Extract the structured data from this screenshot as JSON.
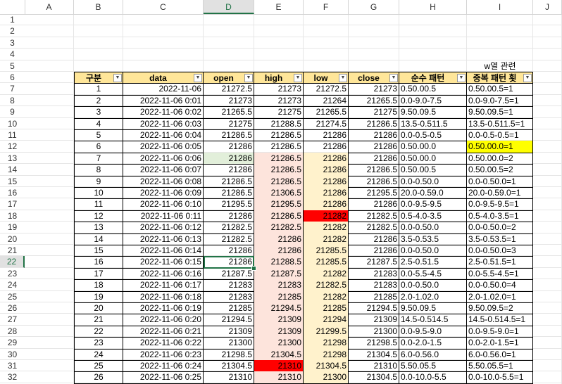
{
  "columns": [
    "A",
    "B",
    "C",
    "D",
    "E",
    "F",
    "G",
    "H",
    "I",
    "J"
  ],
  "selected_column": "D",
  "selected_row": 22,
  "rows": [
    1,
    2,
    3,
    4,
    5,
    6,
    7,
    8,
    9,
    10,
    11,
    12,
    13,
    14,
    15,
    16,
    17,
    18,
    19,
    20,
    21,
    22,
    23,
    24,
    25,
    26,
    27,
    28,
    29,
    30,
    31,
    32
  ],
  "note_cell": "w열 관련",
  "headers": [
    "구분",
    "data",
    "open",
    "high",
    "low",
    "close",
    "순수 패턴",
    "중복 패턴 횟"
  ],
  "filter_icon": "dropdown-arrow-icon",
  "colors": {
    "header_fill": "#ffe699",
    "red": "#ff0000",
    "yellow": "#ffff00",
    "pink_light": "#fde4dc",
    "orange_light": "#fff2cc",
    "green_light": "#e2efda",
    "selection": "#217346"
  },
  "data": [
    {
      "n": "1",
      "dt": "2022-11-06",
      "o": "21272.5",
      "h": "21273",
      "l": "21272.5",
      "c": "21273",
      "p": "0.50.00.5",
      "q": "0.50.00.5=1"
    },
    {
      "n": "2",
      "dt": "2022-11-06 0:01",
      "o": "21273",
      "h": "21273",
      "l": "21264",
      "c": "21265.5",
      "p": "0.0-9.0-7.5",
      "q": "0.0-9.0-7.5=1"
    },
    {
      "n": "3",
      "dt": "2022-11-06 0:02",
      "o": "21265.5",
      "h": "21275",
      "l": "21265.5",
      "c": "21275",
      "p": "9.50.09.5",
      "q": "9.50.09.5=1"
    },
    {
      "n": "4",
      "dt": "2022-11-06 0:03",
      "o": "21275",
      "h": "21288.5",
      "l": "21274.5",
      "c": "21286.5",
      "p": "13.5-0.511.5",
      "q": "13.5-0.511.5=1"
    },
    {
      "n": "5",
      "dt": "2022-11-06 0:04",
      "o": "21286.5",
      "h": "21286.5",
      "l": "21286",
      "c": "21286",
      "p": "0.0-0.5-0.5",
      "q": "0.0-0.5-0.5=1"
    },
    {
      "n": "6",
      "dt": "2022-11-06 0:05",
      "o": "21286",
      "h": "21286.5",
      "l": "21286",
      "c": "21286",
      "p": "0.50.00.0",
      "q": "0.50.00.0=1"
    },
    {
      "n": "7",
      "dt": "2022-11-06 0:06",
      "o": "21286",
      "h": "21286.5",
      "l": "21286",
      "c": "21286",
      "p": "0.50.00.0",
      "q": "0.50.00.0=2"
    },
    {
      "n": "8",
      "dt": "2022-11-06 0:07",
      "o": "21286",
      "h": "21286.5",
      "l": "21286",
      "c": "21286.5",
      "p": "0.50.00.5",
      "q": "0.50.00.5=2"
    },
    {
      "n": "9",
      "dt": "2022-11-06 0:08",
      "o": "21286.5",
      "h": "21286.5",
      "l": "21286",
      "c": "21286.5",
      "p": "0.0-0.50.0",
      "q": "0.0-0.50.0=1"
    },
    {
      "n": "10",
      "dt": "2022-11-06 0:09",
      "o": "21286.5",
      "h": "21306.5",
      "l": "21286",
      "c": "21295.5",
      "p": "20.0-0.59.0",
      "q": "20.0-0.59.0=1"
    },
    {
      "n": "11",
      "dt": "2022-11-06 0:10",
      "o": "21295.5",
      "h": "21295.5",
      "l": "21286",
      "c": "21286",
      "p": "0.0-9.5-9.5",
      "q": "0.0-9.5-9.5=1"
    },
    {
      "n": "12",
      "dt": "2022-11-06 0:11",
      "o": "21286",
      "h": "21286.5",
      "l": "21282",
      "c": "21282.5",
      "p": "0.5-4.0-3.5",
      "q": "0.5-4.0-3.5=1"
    },
    {
      "n": "13",
      "dt": "2022-11-06 0:12",
      "o": "21282.5",
      "h": "21282.5",
      "l": "21282",
      "c": "21282.5",
      "p": "0.0-0.50.0",
      "q": "0.0-0.50.0=2"
    },
    {
      "n": "14",
      "dt": "2022-11-06 0:13",
      "o": "21282.5",
      "h": "21286",
      "l": "21282",
      "c": "21286",
      "p": "3.5-0.53.5",
      "q": "3.5-0.53.5=1"
    },
    {
      "n": "15",
      "dt": "2022-11-06 0:14",
      "o": "21286",
      "h": "21286",
      "l": "21285.5",
      "c": "21286",
      "p": "0.0-0.50.0",
      "q": "0.0-0.50.0=3"
    },
    {
      "n": "16",
      "dt": "2022-11-06 0:15",
      "o": "21286",
      "h": "21288.5",
      "l": "21285.5",
      "c": "21287.5",
      "p": "2.5-0.51.5",
      "q": "2.5-0.51.5=1"
    },
    {
      "n": "17",
      "dt": "2022-11-06 0:16",
      "o": "21287.5",
      "h": "21287.5",
      "l": "21282",
      "c": "21283",
      "p": "0.0-5.5-4.5",
      "q": "0.0-5.5-4.5=1"
    },
    {
      "n": "18",
      "dt": "2022-11-06 0:17",
      "o": "21283",
      "h": "21283",
      "l": "21282.5",
      "c": "21283",
      "p": "0.0-0.50.0",
      "q": "0.0-0.50.0=4"
    },
    {
      "n": "19",
      "dt": "2022-11-06 0:18",
      "o": "21283",
      "h": "21285",
      "l": "21282",
      "c": "21285",
      "p": "2.0-1.02.0",
      "q": "2.0-1.02.0=1"
    },
    {
      "n": "20",
      "dt": "2022-11-06 0:19",
      "o": "21285",
      "h": "21294.5",
      "l": "21285",
      "c": "21294.5",
      "p": "9.50.09.5",
      "q": "9.50.09.5=2"
    },
    {
      "n": "21",
      "dt": "2022-11-06 0:20",
      "o": "21294.5",
      "h": "21309",
      "l": "21294",
      "c": "21309",
      "p": "14.5-0.514.5",
      "q": "14.5-0.514.5=1"
    },
    {
      "n": "22",
      "dt": "2022-11-06 0:21",
      "o": "21309",
      "h": "21309",
      "l": "21299.5",
      "c": "21300",
      "p": "0.0-9.5-9.0",
      "q": "0.0-9.5-9.0=1"
    },
    {
      "n": "23",
      "dt": "2022-11-06 0:22",
      "o": "21300",
      "h": "21300",
      "l": "21298",
      "c": "21298.5",
      "p": "0.0-2.0-1.5",
      "q": "0.0-2.0-1.5=1"
    },
    {
      "n": "24",
      "dt": "2022-11-06 0:23",
      "o": "21298.5",
      "h": "21304.5",
      "l": "21298",
      "c": "21304.5",
      "p": "6.0-0.56.0",
      "q": "6.0-0.56.0=1"
    },
    {
      "n": "25",
      "dt": "2022-11-06 0:24",
      "o": "21304.5",
      "h": "21310",
      "l": "21304.5",
      "c": "21310",
      "p": "5.50.05.5",
      "q": "5.50.05.5=1"
    },
    {
      "n": "26",
      "dt": "2022-11-06 0:25",
      "o": "21310",
      "h": "21310",
      "l": "21300",
      "c": "21304.5",
      "p": "0.0-10.0-5.5",
      "q": "0.0-10.0-5.5=1"
    }
  ]
}
